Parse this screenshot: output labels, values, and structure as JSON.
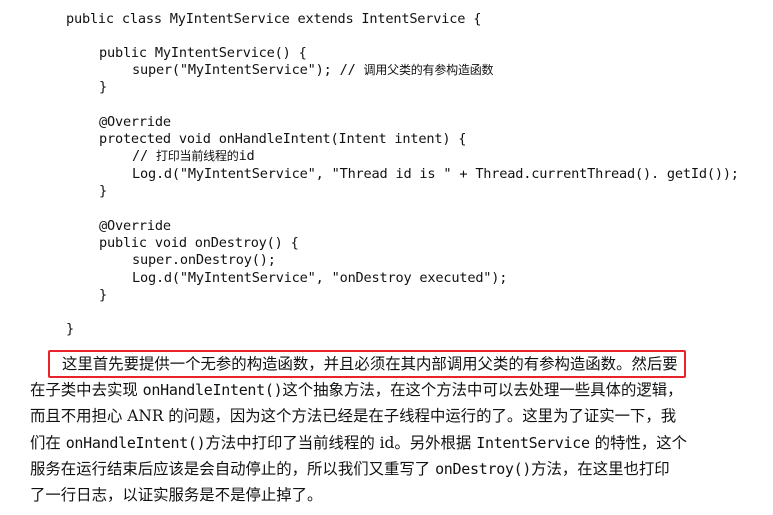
{
  "code": {
    "lines": [
      "public class MyIntentService extends IntentService {",
      "public MyIntentService() {",
      "super(\"MyIntentService\"); //",
      "调用父类的有参构造函数",
      "}",
      "@Override",
      "protected void onHandleIntent(Intent intent) {",
      "//",
      "打印当前线程的",
      "id",
      "Log.d(\"MyIntentService\", \"Thread id is \" + Thread.currentThread(). getId());",
      "}",
      "@Override",
      "public void onDestroy() {",
      "super.onDestroy();",
      "Log.d(\"MyIntentService\", \"onDestroy executed\");",
      "}",
      "}"
    ]
  },
  "paragraph": {
    "line1_highlighted": "这里首先要提供一个无参的构造函数，并且必须在其内部调用父类的有参构造函数",
    "line1_tail": "。然后要",
    "line2_a": "在子类中去实现",
    "line2_code": "onHandleIntent()",
    "line2_b": "这个抽象方法，在这个方法中可以去处理一些具体的逻辑，",
    "line3": "而且不用担心 ANR 的问题，因为这个方法已经是在子线程中运行的了。这里为了证实一下，我",
    "line4_a": "们在",
    "line4_code1": "onHandleIntent()",
    "line4_b": "方法中打印了当前线程的 id。另外根据",
    "line4_code2": "IntentService",
    "line4_c": "的特性，这个",
    "line5_a": "服务在运行结束后应该是会自动停止的，所以我们又重写了",
    "line5_code": "onDestroy()",
    "line5_b": "方法，在这里也打印",
    "line6": "了一行日志，以证实服务是不是停止掉了。"
  },
  "colors": {
    "highlight_border": "#e8232a",
    "text": "#111111"
  }
}
